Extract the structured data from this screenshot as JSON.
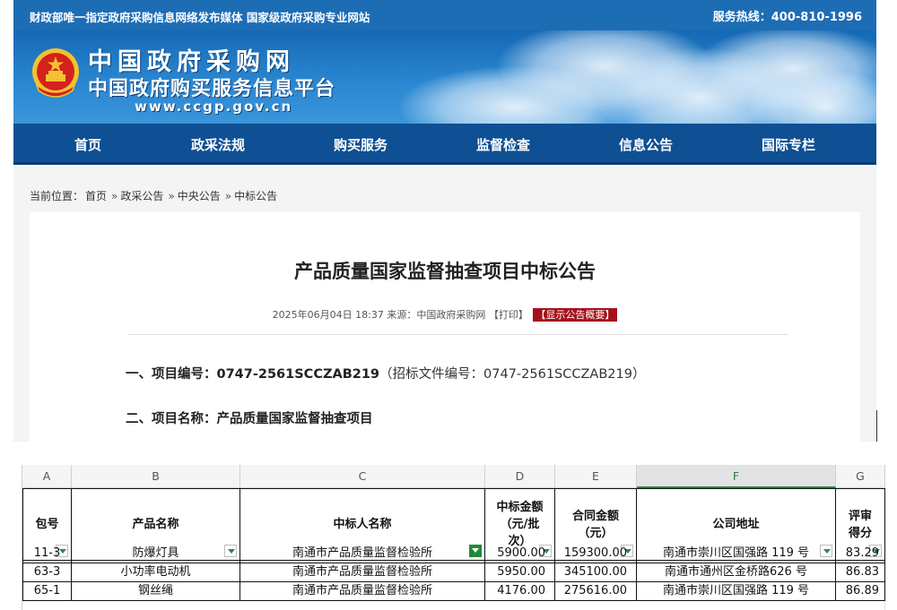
{
  "topbar": {
    "slogan": "财政部唯一指定政府采购信息网络发布媒体 国家级政府采购专业网站",
    "hotline": "服务热线：400-810-1996"
  },
  "banner": {
    "site_name": "中国政府采购网",
    "site_subtitle": "中国政府购买服务信息平台",
    "site_url": "www.ccgp.gov.cn"
  },
  "nav": {
    "items": [
      "首页",
      "政采法规",
      "购买服务",
      "监督检查",
      "信息公告",
      "国际专栏"
    ]
  },
  "breadcrumb": {
    "prefix": "当前位置：",
    "items": [
      "首页",
      "政采公告",
      "中央公告",
      "中标公告"
    ],
    "separator": "»"
  },
  "notice": {
    "title": "产品质量国家监督抽查项目中标公告",
    "date": "2025年06月04日 18:37",
    "source": "来源：中国政府采购网",
    "print_label": "【打印】",
    "summary_label": "【显示公告概要】",
    "item1_label": "一、项目编号：",
    "item1_value": "0747-2561SCCZAB219",
    "item1_note": "（招标文件编号：0747-2561SCCZAB219）",
    "item2_label": "二、项目名称：",
    "item2_value": "产品质量国家监督抽查项目"
  },
  "sheet": {
    "columns": [
      "A",
      "B",
      "C",
      "D",
      "E",
      "F",
      "G"
    ],
    "selected_column": "F",
    "headers": [
      "包号",
      "产品名称",
      "中标人名称",
      "中标金额（元/批次）",
      "合同金额（元）",
      "公司地址",
      "评审得分"
    ],
    "header_lines": {
      "D": [
        "中标金额",
        "（元/批",
        "次）"
      ],
      "E": [
        "合同金额",
        "（元）"
      ],
      "G": [
        "评审",
        "得分"
      ]
    },
    "rows": [
      [
        "11-3",
        "防爆灯具",
        "南通市产品质量监督检验所",
        "5900.00",
        "159300.00",
        "南通市崇川区国强路 119 号",
        "83.29"
      ],
      [
        "63-3",
        "小功率电动机",
        "南通市产品质量监督检验所",
        "5950.00",
        "345100.00",
        "南通市通州区金桥路626 号",
        "86.83"
      ],
      [
        "65-1",
        "钢丝绳",
        "南通市产品质量监督检验所",
        "4176.00",
        "275616.00",
        "南通市崇川区国强路 119 号",
        "86.89"
      ]
    ]
  },
  "colors": {
    "topbar": "#1d6db5",
    "nav": "#0f4f93",
    "badge": "#a5111b",
    "filter_active": "#1f8a3b"
  },
  "icons": {
    "emblem": "national-emblem-icon",
    "filter": "filter-dropdown-icon",
    "filter_active": "filter-active-icon"
  }
}
